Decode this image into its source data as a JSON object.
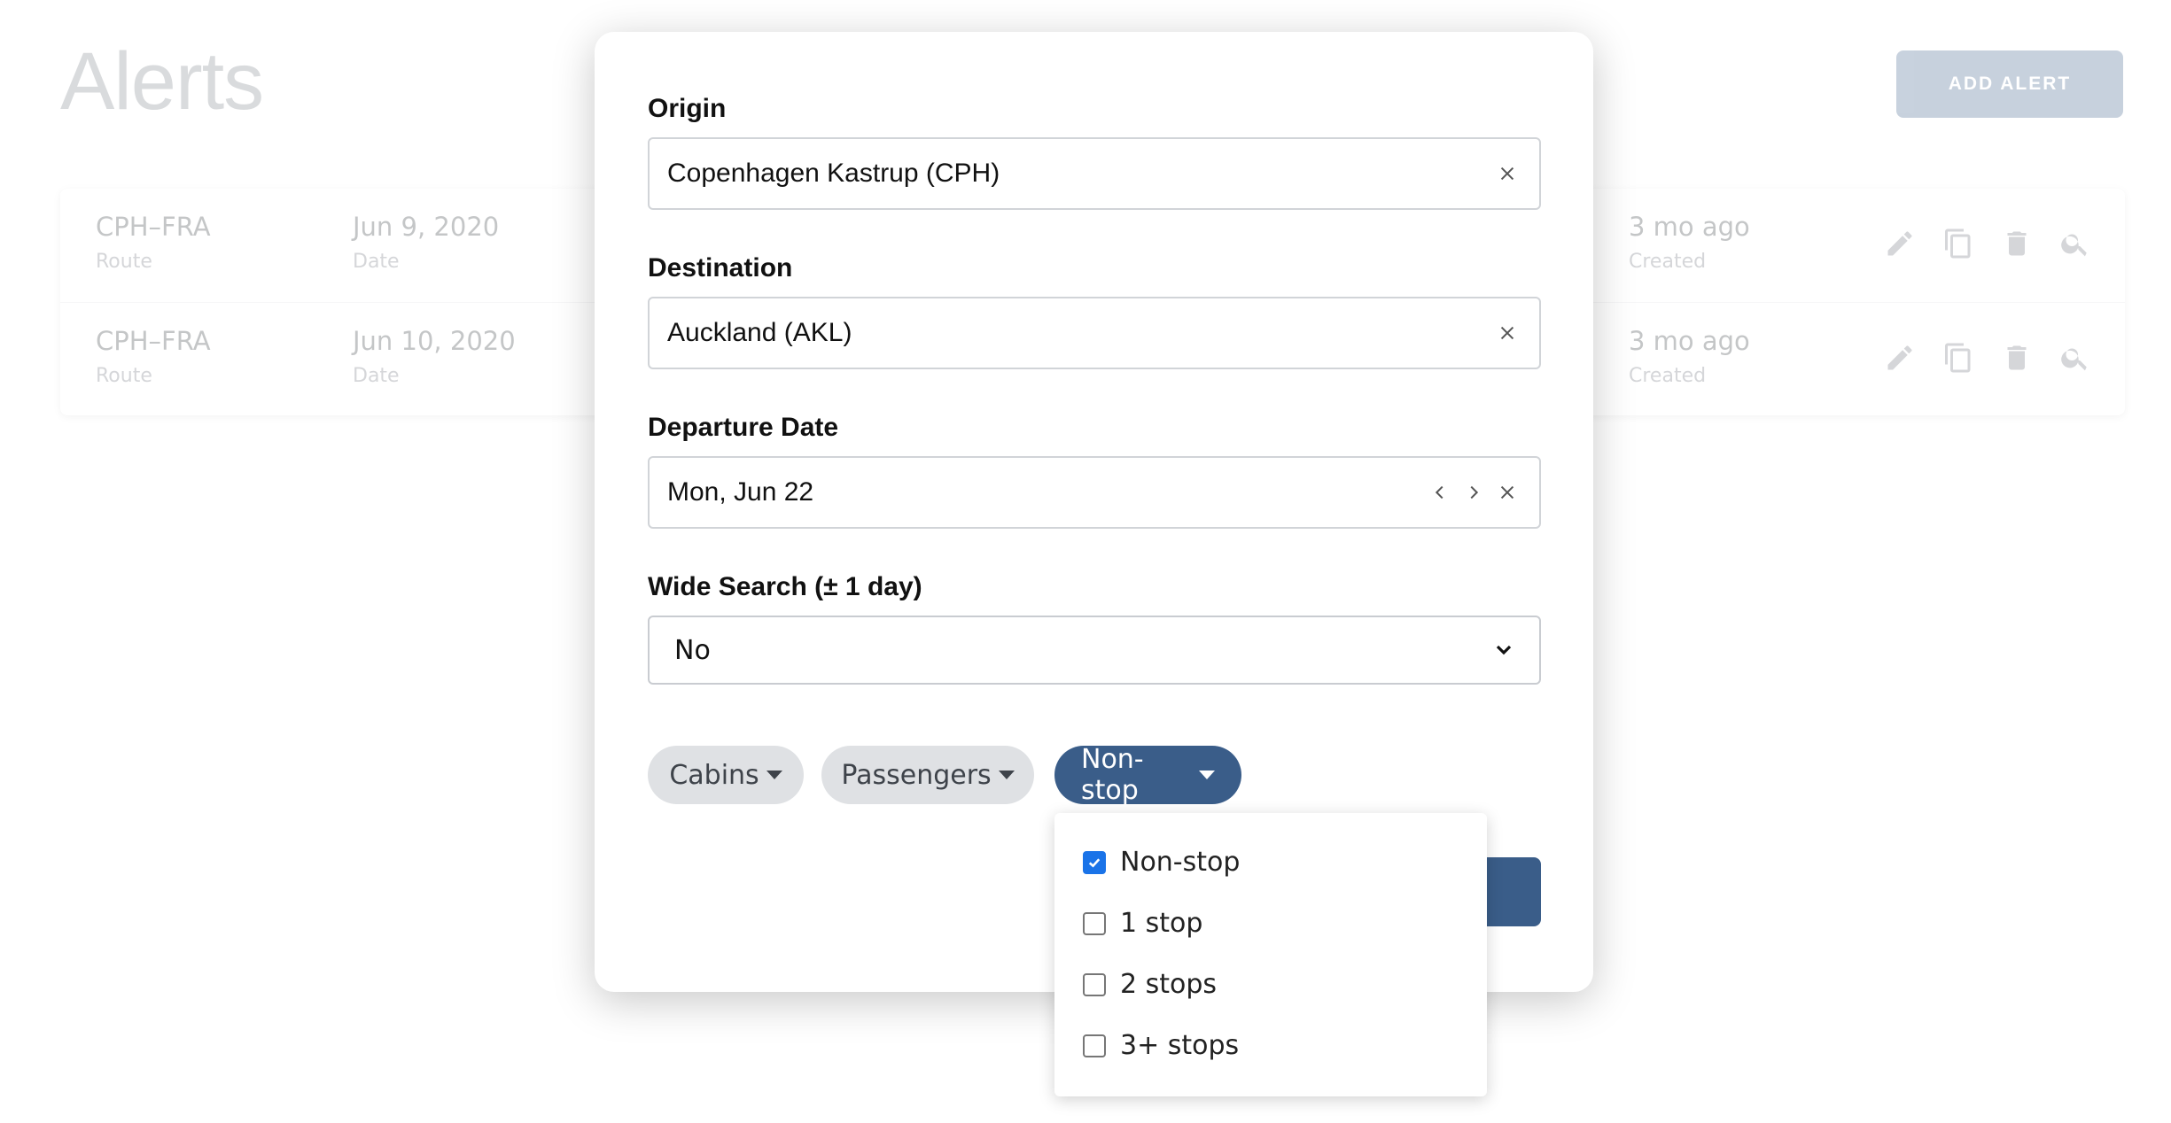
{
  "page": {
    "title": "Alerts",
    "add_alert_label": "ADD ALERT",
    "alerts": [
      {
        "route": "CPH–FRA",
        "route_label": "Route",
        "date": "Jun 9, 2020",
        "date_label": "Date",
        "created": "3 mo ago",
        "created_label": "Created"
      },
      {
        "route": "CPH–FRA",
        "route_label": "Route",
        "date": "Jun 10, 2020",
        "date_label": "Date",
        "created": "3 mo ago",
        "created_label": "Created"
      }
    ]
  },
  "modal": {
    "origin": {
      "label": "Origin",
      "value": "Copenhagen Kastrup (CPH)"
    },
    "destination": {
      "label": "Destination",
      "value": "Auckland (AKL)"
    },
    "departure": {
      "label": "Departure Date",
      "value": "Mon, Jun 22"
    },
    "wide_search": {
      "label": "Wide Search (± 1 day)",
      "value": "No"
    },
    "filters": {
      "cabins": "Cabins",
      "passengers": "Passengers",
      "stops": "Non-stop"
    },
    "stops_options": [
      {
        "label": "Non-stop",
        "checked": true
      },
      {
        "label": "1 stop",
        "checked": false
      },
      {
        "label": "2 stops",
        "checked": false
      },
      {
        "label": "3+ stops",
        "checked": false
      }
    ]
  },
  "colors": {
    "primary": "#3a5d89",
    "checkbox_checked": "#1a73e8",
    "pill_grey": "#dfe1e4"
  }
}
